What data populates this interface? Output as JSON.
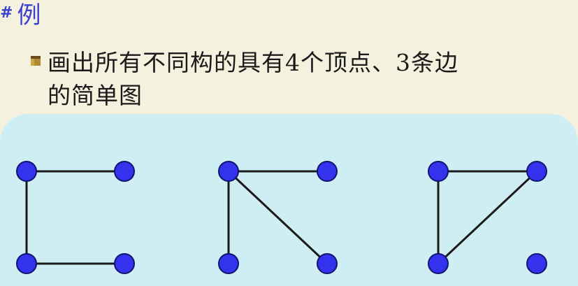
{
  "slide": {
    "title_mark": "#",
    "title": "例",
    "problem_line1": "画出所有不同构的具有4个顶点、3条边",
    "problem_line2": "的简单图"
  },
  "colors": {
    "title": "#3b3fd0",
    "vertex_fill": "#3333ee",
    "edge": "#1a1a1a",
    "panel_background": "#cfeef4",
    "slide_background": "#f4f2de"
  },
  "graphs": [
    {
      "vertices": [
        "top-left",
        "top-right",
        "bottom-left",
        "bottom-right"
      ],
      "edges": [
        [
          "top-left",
          "top-right"
        ],
        [
          "top-left",
          "bottom-left"
        ],
        [
          "bottom-left",
          "bottom-right"
        ]
      ]
    },
    {
      "vertices": [
        "top-left",
        "top-right",
        "bottom-left",
        "bottom-right"
      ],
      "edges": [
        [
          "top-left",
          "top-right"
        ],
        [
          "top-left",
          "bottom-left"
        ],
        [
          "top-left",
          "bottom-right"
        ]
      ]
    },
    {
      "vertices": [
        "top-left",
        "top-right",
        "bottom-left",
        "bottom-right"
      ],
      "edges": [
        [
          "top-left",
          "top-right"
        ],
        [
          "top-left",
          "bottom-left"
        ],
        [
          "bottom-left",
          "top-right"
        ]
      ]
    }
  ]
}
